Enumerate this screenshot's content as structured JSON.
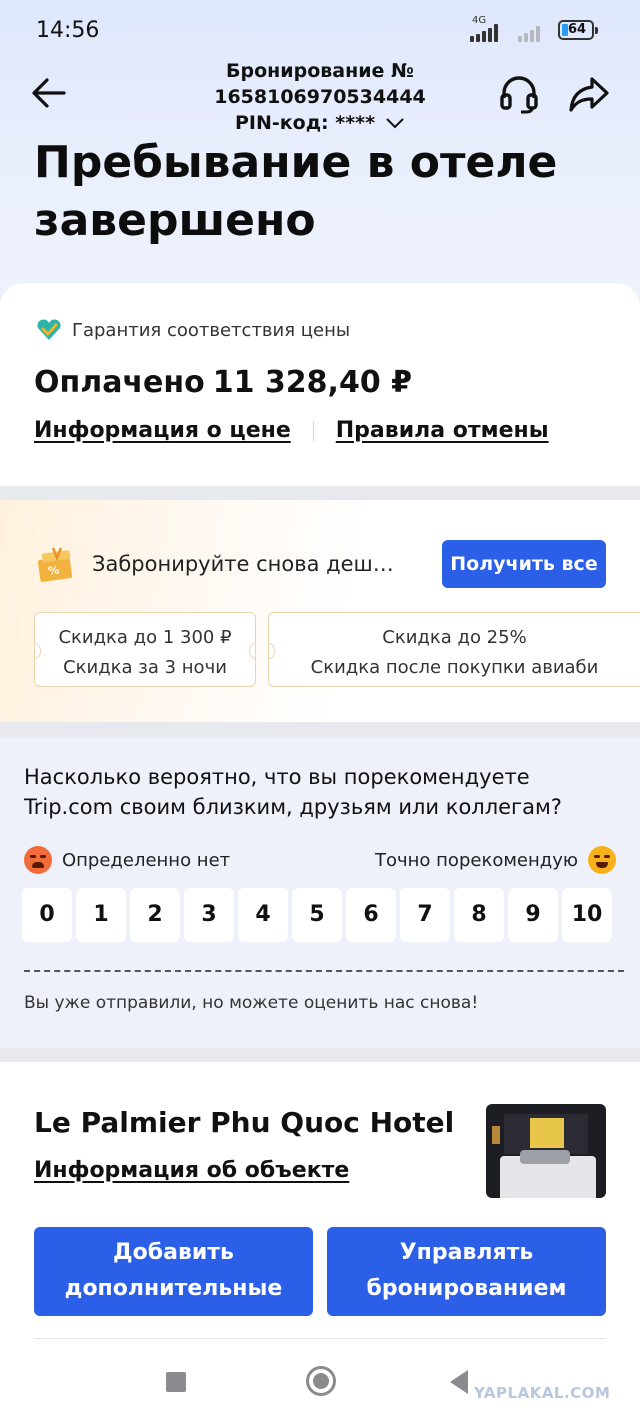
{
  "status_bar": {
    "time": "14:56",
    "network": "4G",
    "battery": "64"
  },
  "header": {
    "booking_label": "Бронирование №",
    "booking_number": "1658106970534444",
    "pin_label": "PIN-код: ****"
  },
  "hero": {
    "title": "Пребывание в отеле завершено"
  },
  "price": {
    "guarantee": "Гарантия соответствия цены",
    "paid_label": "Оплачено",
    "amount": "11 328,40 ₽",
    "price_info_link": "Информация о цене",
    "cancel_rules_link": "Правила отмены"
  },
  "promo": {
    "text": "Забронируйте снова деш…",
    "get_all_button": "Получить все",
    "coupons": [
      {
        "title": "Скидка до 1 300 ₽",
        "subtitle": "Скидка за 3 ночи"
      },
      {
        "title": "Скидка до 25%",
        "subtitle": "Скидка после покупки авиаби"
      }
    ]
  },
  "survey": {
    "question": "Насколько вероятно, что вы порекомендуете Trip.com своим близким, друзьям или коллегам?",
    "left_label": "Определенно нет",
    "right_label": "Точно порекомендую",
    "scores": [
      "0",
      "1",
      "2",
      "3",
      "4",
      "5",
      "6",
      "7",
      "8",
      "9",
      "10"
    ],
    "note": "Вы уже отправили, но можете оценить нас снова!"
  },
  "hotel": {
    "name": "Le Palmier Phu Quoc Hotel",
    "info_link": "Информация об объекте",
    "add_button": "Добавить дополнительные ком…",
    "manage_button": "Управлять бронированием"
  },
  "watermark": "YAPLAKAL.COM",
  "colors": {
    "accent": "#2c5fe8",
    "coupon_border": "#ecd3b0",
    "survey_bg": "#eef1fa"
  }
}
